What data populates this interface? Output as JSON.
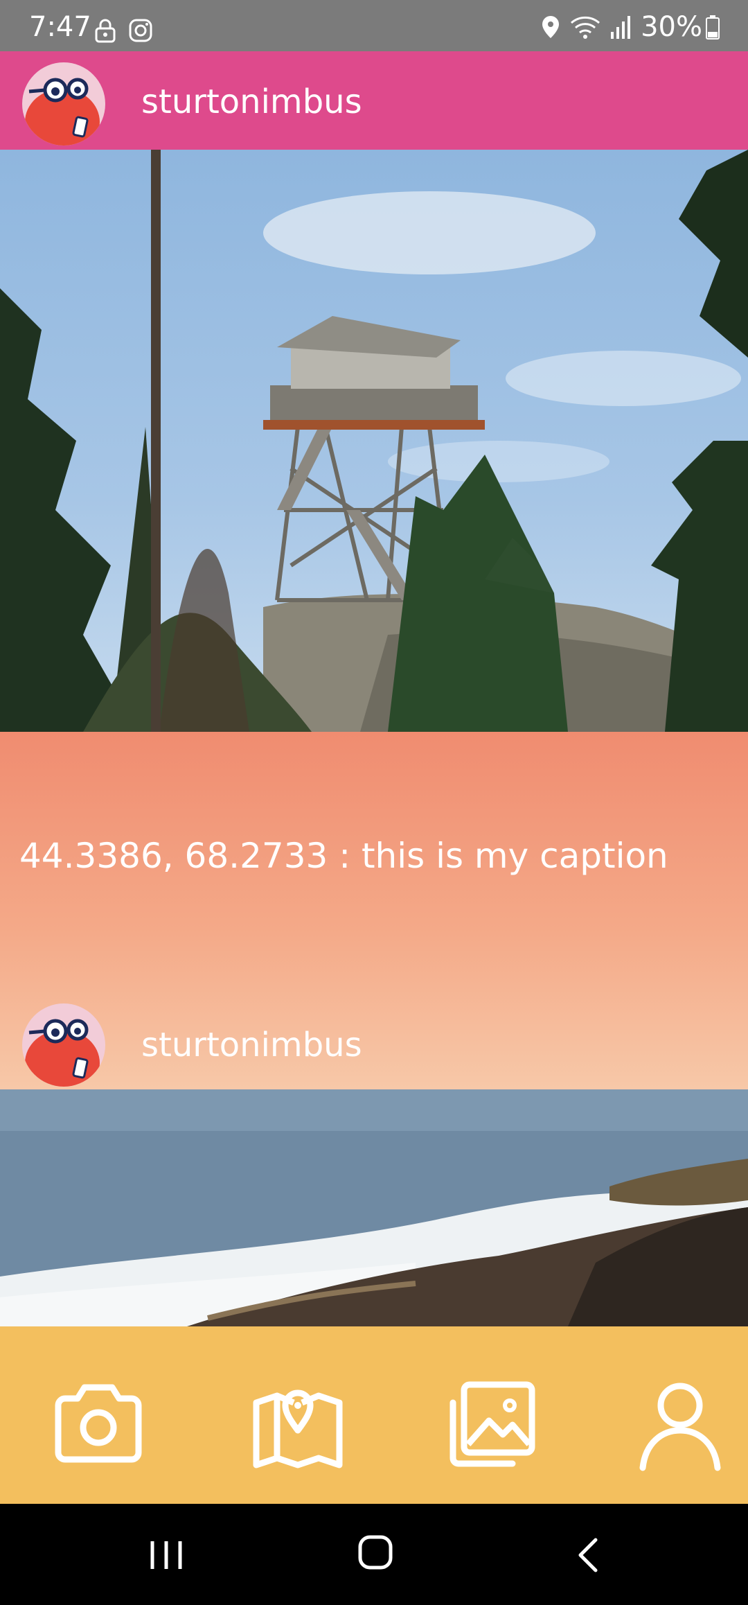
{
  "status_bar": {
    "time": "7:47",
    "left_icons": [
      "lock-icon",
      "instagram-icon"
    ],
    "right_icons": [
      "location-icon",
      "wifi-icon",
      "signal-icon",
      "battery-icon"
    ],
    "battery": "30%"
  },
  "header": {
    "username": "sturtonimbus",
    "avatar": "beaver-avatar"
  },
  "posts": [
    {
      "image": "fire lookout tower among pine trees",
      "caption": "44.3386, 68.2733 : this is my caption"
    },
    {
      "username": "sturtonimbus",
      "avatar": "beaver-avatar",
      "image": "ocean waves on rocky coast"
    }
  ],
  "bottom_nav": {
    "items": [
      "camera-icon",
      "map-icon",
      "gallery-icon",
      "profile-icon"
    ]
  },
  "system_nav": {
    "items": [
      "recent-apps-icon",
      "home-icon",
      "back-icon"
    ]
  },
  "colors": {
    "header": "#de4a8c",
    "caption_gradient_top": "#f08c70",
    "caption_gradient_bottom": "#f7c8a8",
    "bottom_nav": "#f3bf5e",
    "status_bar": "#7b7b7b"
  }
}
